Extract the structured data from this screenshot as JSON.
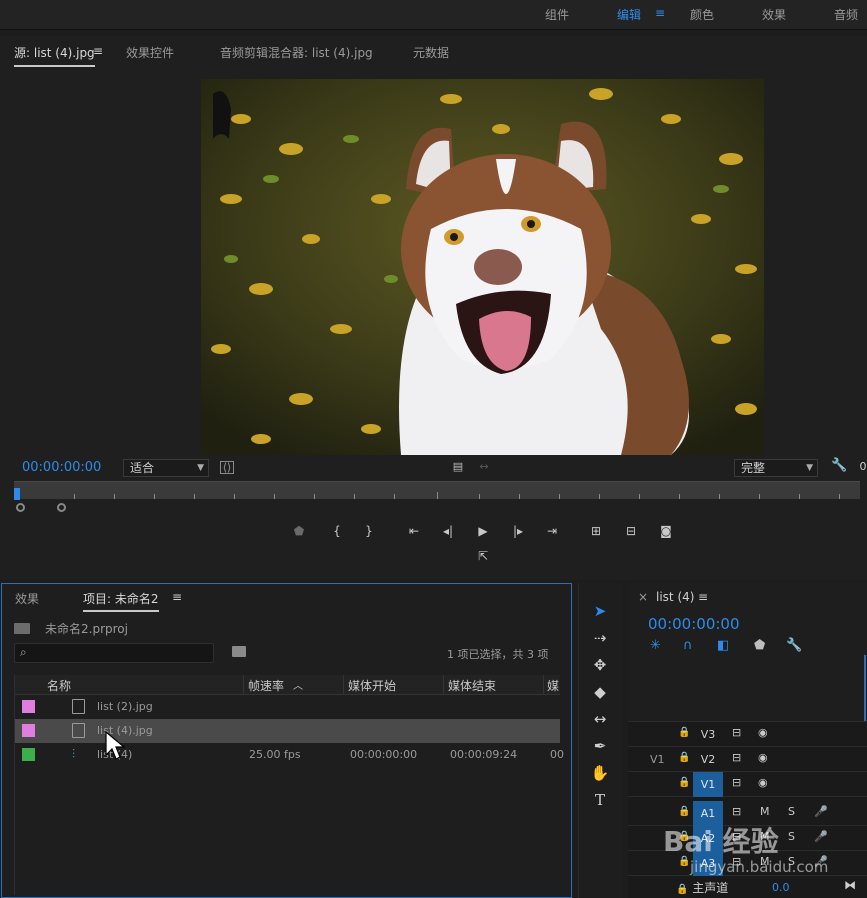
{
  "workspace": {
    "items": [
      "组件",
      "编辑",
      "颜色",
      "效果",
      "音频"
    ],
    "active": "编辑",
    "menu_icon": "hamburger-icon"
  },
  "source_panel": {
    "tabs": [
      "源: list (4).jpg",
      "效果控件",
      "音频剪辑混合器: list (4).jpg",
      "元数据"
    ],
    "active_tab": "源: list (4).jpg",
    "timecode": "00:00:00:00",
    "fit_value": "适合",
    "quality_value": "完整",
    "right_cut_value": "0"
  },
  "project_panel": {
    "tabs": [
      "效果",
      "项目: 未命名2"
    ],
    "project_file": "未命名2.prproj",
    "search_placeholder": "",
    "selection_info": "1 项已选择，共 3 项",
    "columns": [
      "名称",
      "帧速率",
      "媒体开始",
      "媒体结束",
      "媒"
    ],
    "rows": [
      {
        "name": "list (2).jpg",
        "color": "#e07ee0",
        "icon": "image-file-icon",
        "fps": "",
        "start": "",
        "end": "",
        "extra": ""
      },
      {
        "name": "list (4).jpg",
        "color": "#e07ee0",
        "icon": "image-file-icon",
        "fps": "",
        "start": "",
        "end": "",
        "extra": ""
      },
      {
        "name": "list (4)",
        "color": "#3bb04a",
        "icon": "sequence-icon",
        "fps": "25.00 fps",
        "start": "00:00:00:00",
        "end": "00:00:09:24",
        "extra": "00"
      }
    ]
  },
  "timeline_panel": {
    "tab": "list (4)",
    "timecode": "00:00:00:00",
    "tracks": [
      {
        "name": "V3",
        "left": ""
      },
      {
        "name": "V2",
        "left": "V1"
      },
      {
        "name": "V1",
        "left": ""
      },
      {
        "name": "A1",
        "left": "",
        "m": "M",
        "s": "S"
      },
      {
        "name": "A2",
        "left": "",
        "m": "M",
        "s": "S"
      },
      {
        "name": "A3",
        "left": "",
        "m": "M",
        "s": "S"
      }
    ],
    "master_label": "主声道",
    "master_value": "0.0"
  },
  "watermark": {
    "text": "Bai 经验",
    "sub": "jingyan.baidu.com"
  },
  "colors": {
    "accent": "#2d8ceb",
    "panel_bg": "#1f1f1f",
    "selected_row": "#4a4a4a"
  }
}
